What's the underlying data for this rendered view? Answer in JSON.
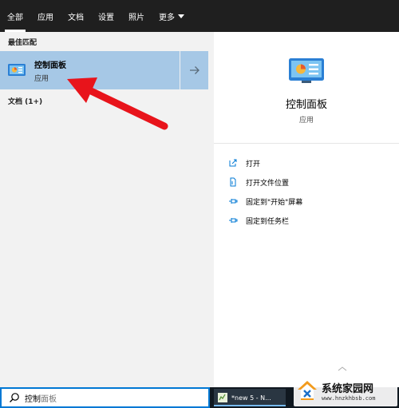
{
  "tabs": [
    {
      "label": "全部"
    },
    {
      "label": "应用"
    },
    {
      "label": "文档"
    },
    {
      "label": "设置"
    },
    {
      "label": "照片"
    },
    {
      "label": "更多"
    }
  ],
  "results": {
    "best_match_heading": "最佳匹配",
    "best_match": {
      "title": "控制面板",
      "subtitle": "应用",
      "icon": "control-panel-icon"
    },
    "documents_heading": "文档 (1+)"
  },
  "preview": {
    "title": "控制面板",
    "subtitle": "应用",
    "actions": [
      {
        "label": "打开",
        "icon": "open-icon"
      },
      {
        "label": "打开文件位置",
        "icon": "file-location-icon"
      },
      {
        "label": "固定到\"开始\"屏幕",
        "icon": "pin-icon"
      },
      {
        "label": "固定到任务栏",
        "icon": "pin-icon"
      }
    ]
  },
  "search": {
    "typed": "控制",
    "suggestion": "面板"
  },
  "taskbar": {
    "item_label": "*new 5 - N..."
  },
  "watermark": {
    "title": "系统家园网",
    "url": "www.hnzkhbsb.com"
  },
  "colors": {
    "accent": "#0078d4",
    "selection": "#a6c8e6",
    "annotation": "#e8141b",
    "topbar": "#1f1f1f"
  }
}
